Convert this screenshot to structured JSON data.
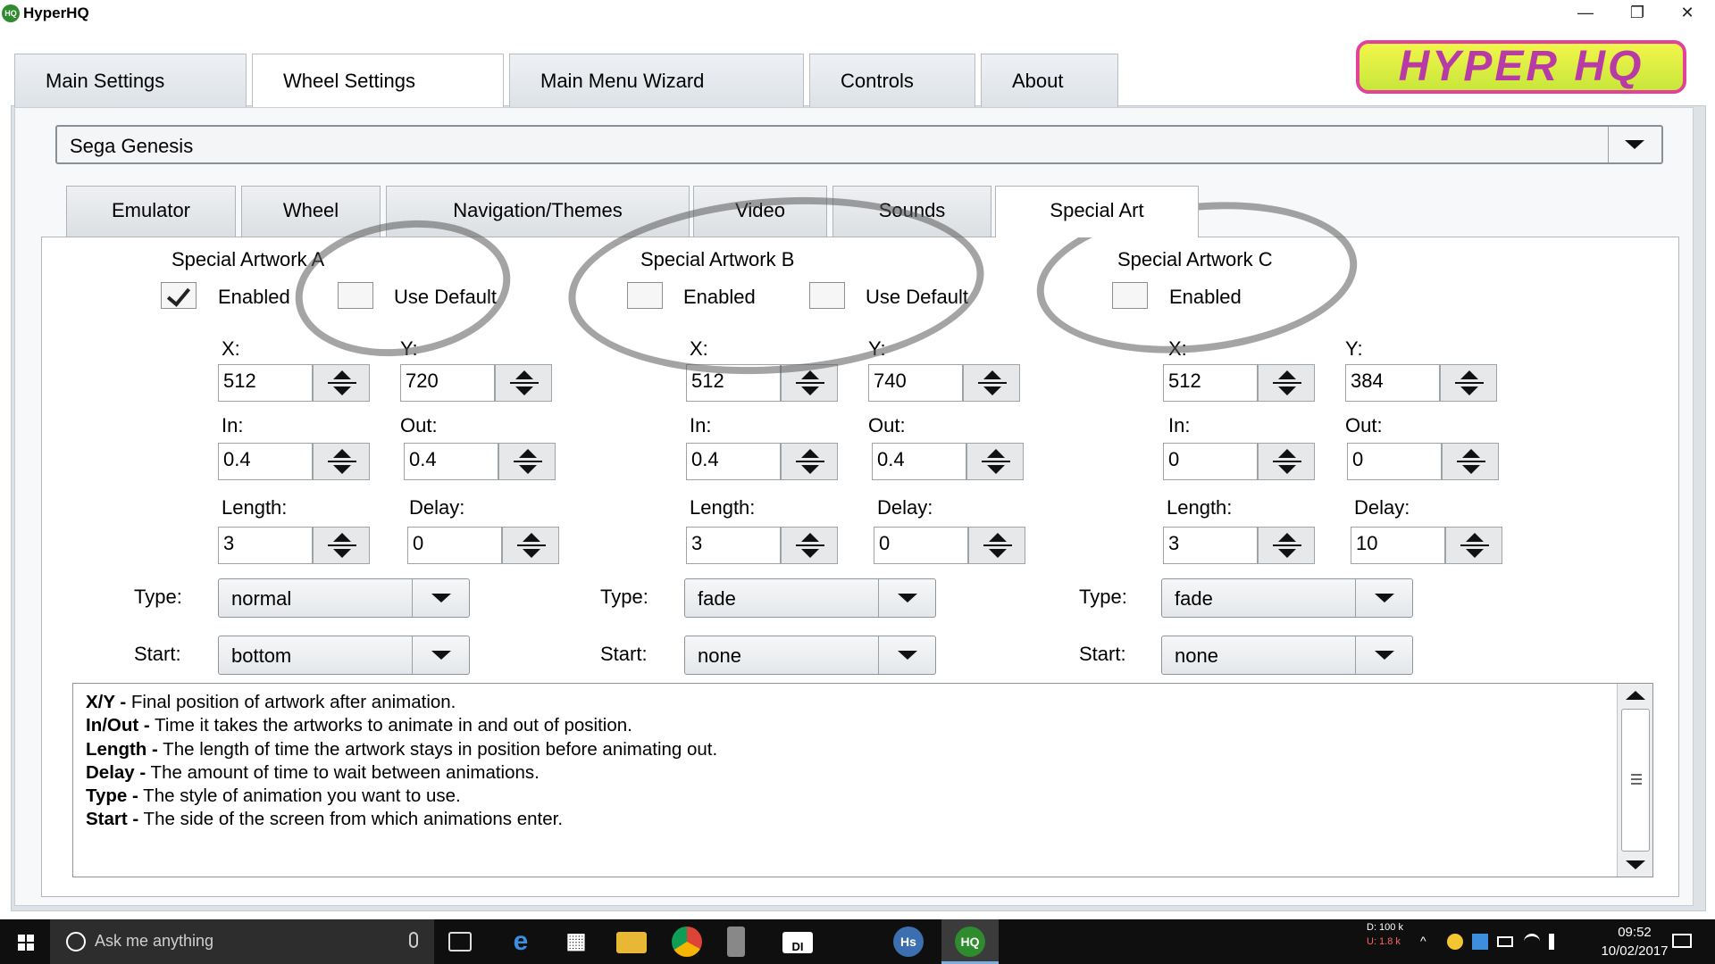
{
  "window": {
    "app_icon": "HQ",
    "title": "HyperHQ",
    "minimize": "—",
    "restore": "❐",
    "close": "✕"
  },
  "logo_text": "HYPER HQ",
  "main_tabs": [
    "Main Settings",
    "Wheel Settings",
    "Main Menu Wizard",
    "Controls",
    "About"
  ],
  "system_select": {
    "value": "Sega Genesis"
  },
  "sub_tabs": [
    "Emulator",
    "Wheel",
    "Navigation/Themes",
    "Video",
    "Sounds",
    "Special Art"
  ],
  "labels": {
    "enabled": "Enabled",
    "use_default": "Use Default",
    "x": "X:",
    "y": "Y:",
    "in": "In:",
    "out": "Out:",
    "length": "Length:",
    "delay": "Delay:",
    "type": "Type:",
    "start": "Start:"
  },
  "artworks": [
    {
      "title": "Special Artwork A",
      "enabled": true,
      "use_default": false,
      "x": "512",
      "y": "720",
      "in": "0.4",
      "out": "0.4",
      "length": "3",
      "delay": "0",
      "type": "normal",
      "start": "bottom"
    },
    {
      "title": "Special Artwork B",
      "enabled": false,
      "use_default": false,
      "x": "512",
      "y": "740",
      "in": "0.4",
      "out": "0.4",
      "length": "3",
      "delay": "0",
      "type": "fade",
      "start": "none"
    },
    {
      "title": "Special Artwork C",
      "enabled": false,
      "x": "512",
      "y": "384",
      "in": "0",
      "out": "0",
      "length": "3",
      "delay": "10",
      "type": "fade",
      "start": "none"
    }
  ],
  "help": [
    {
      "term": "X/Y -",
      "text": " Final position of artwork after animation."
    },
    {
      "term": "In/Out -",
      "text": " Time it takes the artworks to animate in and out of position."
    },
    {
      "term": "Length -",
      "text": " The length of time the artwork stays in position before animating out."
    },
    {
      "term": "Delay -",
      "text": " The amount of time to wait between animations."
    },
    {
      "term": "Type -",
      "text": " The style of animation you want to use."
    },
    {
      "term": "Start -",
      "text": " The side of the screen from which animations enter."
    }
  ],
  "taskbar": {
    "search_placeholder": "Ask me anything",
    "apps": [
      "task-view",
      "edge",
      "store",
      "file-explorer",
      "chrome",
      "media-player",
      "steam-like",
      "game",
      "hyperspin",
      "hyperhq"
    ],
    "app_glyphs": {
      "edge": "e",
      "store": "▦",
      "di": "DI",
      "hs": "Hs",
      "hq": "HQ"
    },
    "net_down": "D: 100 k",
    "net_up": "U: 1.8 k",
    "time": "09:52",
    "date": "10/02/2017",
    "accent": "#7aaee0"
  }
}
